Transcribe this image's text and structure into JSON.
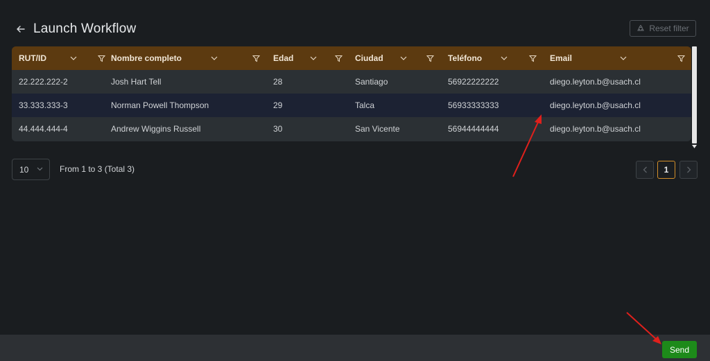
{
  "header": {
    "title": "Launch Workflow",
    "back_icon": "arrow-left-icon"
  },
  "toolbar": {
    "reset_filter_label": "Reset filter",
    "reset_filter_icon": "recycle-icon"
  },
  "table": {
    "columns": [
      {
        "label": "RUT/ID"
      },
      {
        "label": "Nombre completo"
      },
      {
        "label": "Edad"
      },
      {
        "label": "Ciudad"
      },
      {
        "label": "Teléfono"
      },
      {
        "label": "Email"
      }
    ],
    "rows": [
      [
        "22.222.222-2",
        "Josh Hart Tell",
        "28",
        "Santiago",
        "56922222222",
        "diego.leyton.b@usach.cl"
      ],
      [
        "33.333.333-3",
        "Norman Powell Thompson",
        "29",
        "Talca",
        "56933333333",
        "diego.leyton.b@usach.cl"
      ],
      [
        "44.444.444-4",
        "Andrew Wiggins Russell",
        "30",
        "San Vicente",
        "56944444444",
        "diego.leyton.b@usach.cl"
      ]
    ]
  },
  "pagination": {
    "page_size": "10",
    "range_text": "From 1 to 3 (Total 3)",
    "current_page": "1"
  },
  "footer": {
    "send_label": "Send"
  },
  "colors": {
    "header_bg": "#5c3a10",
    "accent": "#d4902a",
    "send": "#1d8a1a",
    "annotation_arrow": "#e0201c"
  }
}
